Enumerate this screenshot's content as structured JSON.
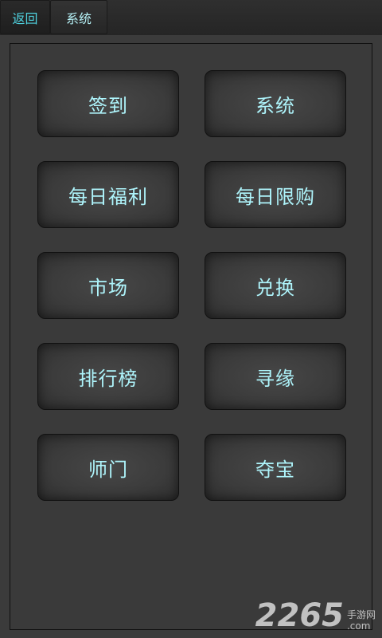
{
  "tabs": {
    "back_label": "返回",
    "system_label": "系统"
  },
  "menu": {
    "items": [
      {
        "label": "签到"
      },
      {
        "label": "系统"
      },
      {
        "label": "每日福利"
      },
      {
        "label": "每日限购"
      },
      {
        "label": "市场"
      },
      {
        "label": "兑换"
      },
      {
        "label": "排行榜"
      },
      {
        "label": "寻缘"
      },
      {
        "label": "师门"
      },
      {
        "label": "夺宝"
      }
    ]
  },
  "watermark": {
    "number": "2265",
    "line1": "手游网",
    "line2": ".com"
  },
  "colors": {
    "accent": "#4fd3e0",
    "button_text": "#aef4fb",
    "background": "#3a3a3a"
  }
}
